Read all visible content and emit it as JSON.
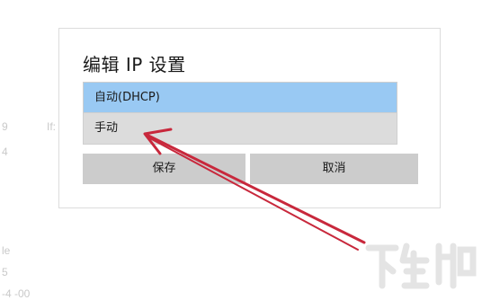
{
  "background_fragments": [
    "9",
    "If:",
    "4",
    "le",
    "5",
    "-4 -00"
  ],
  "dialog": {
    "title": "编辑 IP 设置",
    "options": [
      {
        "label": "自动(DHCP)",
        "state": "selected"
      },
      {
        "label": "手动",
        "state": "hover"
      }
    ],
    "buttons": {
      "save": "保存",
      "cancel": "取消"
    }
  },
  "annotation": {
    "arrow_color": "#c8283c"
  },
  "watermark": {
    "text": "下载吧"
  },
  "colors": {
    "selected_option": "#99c9f3",
    "hover_option": "#dcdcdc",
    "button_bg": "#cccccc"
  }
}
